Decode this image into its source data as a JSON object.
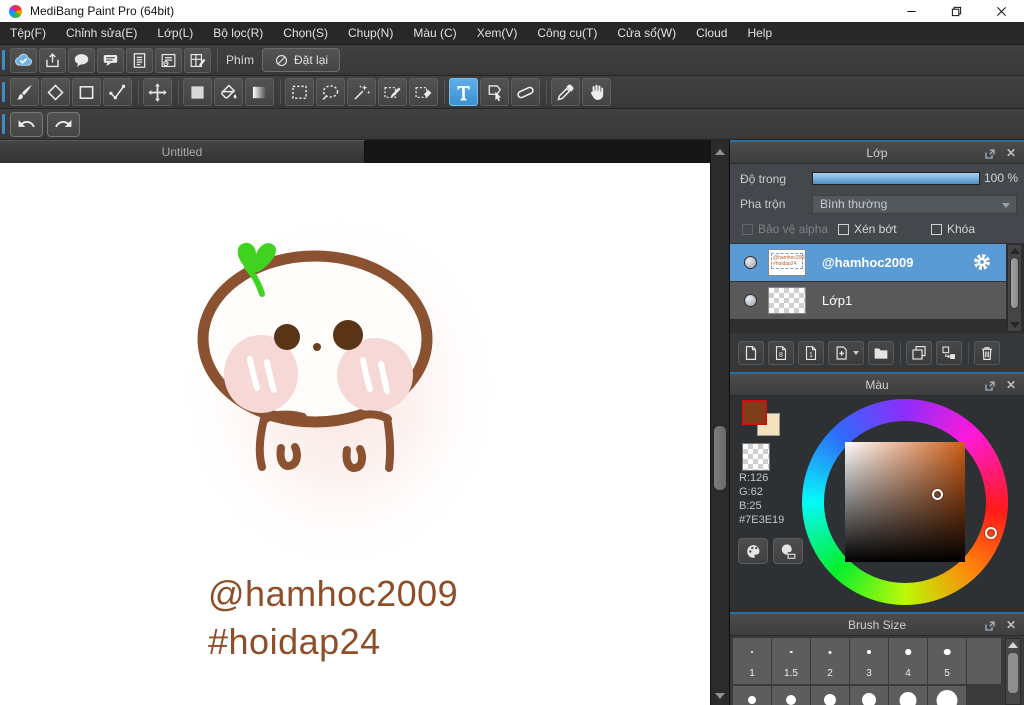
{
  "window": {
    "title": "MediBang Paint Pro (64bit)"
  },
  "menu": {
    "items": [
      "Tệp(F)",
      "Chỉnh sửa(E)",
      "Lớp(L)",
      "Bộ lọc(R)",
      "Chọn(S)",
      "Chụp(N)",
      "Màu (C)",
      "Xem(V)",
      "Công cụ(T)",
      "Cửa sổ(W)",
      "Cloud",
      "Help"
    ]
  },
  "toolbar_top": {
    "buttons": [
      "cloud-sync",
      "publish",
      "comment-round",
      "comment-rect",
      "document",
      "panel-list",
      "comic-panel"
    ],
    "keys_label": "Phím",
    "reset_label": "Đặt lại"
  },
  "toolbar_tools": {
    "tools": [
      "brush",
      "eraser",
      "rectangle",
      "curve",
      "divider",
      "move",
      "divider",
      "fill-rect",
      "bucket",
      "gradient",
      "divider",
      "select-rect",
      "select-lasso",
      "magic-wand",
      "select-pen",
      "select-eraser",
      "divider",
      "text",
      "object-select",
      "divide",
      "divider",
      "eyedropper",
      "hand"
    ],
    "selected": "text"
  },
  "document_tab": {
    "label": "Untitled"
  },
  "canvas": {
    "texts": [
      "@hamhoc2009",
      "#hoidap24"
    ],
    "text_color": "#8d4e28"
  },
  "layer_panel": {
    "title": "Lớp",
    "opacity_label": "Độ trong",
    "opacity_percent": "100 %",
    "blend_label": "Pha trộn",
    "blend_value": "Bình thường",
    "checkbox_alpha": "Bảo vệ alpha",
    "checkbox_clip": "Xén bớt",
    "checkbox_lock": "Khóa",
    "layers": [
      {
        "name": "@hamhoc2009",
        "selected": true,
        "thumb": "text",
        "thumb_lines": [
          "@hamhoc2009",
          "#hoidap24"
        ]
      },
      {
        "name": "Lớp1",
        "selected": false,
        "thumb": "checker",
        "thumb_lines": []
      }
    ],
    "buttons": [
      "new-layer",
      "layer-8bit",
      "layer-1bit",
      "add-folder",
      "folder",
      "divider",
      "duplicate-layer",
      "merge-layer",
      "divider",
      "delete-layer"
    ]
  },
  "color_panel": {
    "title": "Màu",
    "r_label": "R:126",
    "g_label": "G:62",
    "b_label": "B:25",
    "hex_label": "#7E3E19",
    "foreground_color": "#7E3E19",
    "background_color": "#F2E2BF",
    "buttons": [
      "palette",
      "palette-list"
    ]
  },
  "brush_panel": {
    "title": "Brush Size",
    "row1": [
      {
        "label": "1",
        "dot": 2
      },
      {
        "label": "1.5",
        "dot": 2.5
      },
      {
        "label": "2",
        "dot": 3
      },
      {
        "label": "3",
        "dot": 4
      },
      {
        "label": "4",
        "dot": 5.5
      },
      {
        "label": "5",
        "dot": 6.5
      }
    ],
    "row2_dots": [
      8,
      10,
      12,
      14,
      17,
      21
    ]
  },
  "colors": {
    "accent_blue": "#4a9ad4",
    "selection_blue": "#5b9bd5",
    "slider_blue": "#5a9fd4"
  }
}
